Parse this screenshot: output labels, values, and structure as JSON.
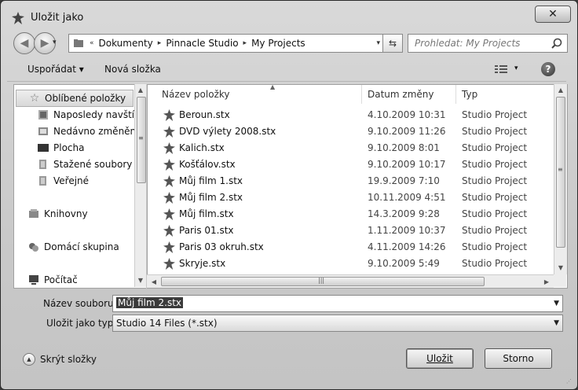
{
  "window": {
    "title": "Uložit jako",
    "close_label": "✕"
  },
  "address": {
    "prefix": "«",
    "segments": [
      "Dokumenty",
      "Pinnacle Studio",
      "My Projects"
    ],
    "separator": "▸",
    "dropdown": "▾"
  },
  "search": {
    "placeholder": "Prohledat: My Projects"
  },
  "toolbar": {
    "organize": "Uspořádat ▾",
    "new_folder": "Nová složka",
    "views_dropdown": "▾",
    "help": "?"
  },
  "nav": {
    "favorites": "Oblíbené položky",
    "recent_places": "Naposledy navštíve",
    "recently_changed": "Nedávno změněné",
    "desktop": "Plocha",
    "downloads": "Stažené soubory",
    "public": "Veřejné",
    "libraries": "Knihovny",
    "homegroup": "Domácí skupina",
    "computer": "Počítač"
  },
  "columns": {
    "name": "Název položky",
    "date": "Datum změny",
    "type": "Typ"
  },
  "files": [
    {
      "name": "Beroun.stx",
      "date": "4.10.2009 10:31",
      "type": "Studio Project"
    },
    {
      "name": "DVD výlety 2008.stx",
      "date": "9.10.2009 11:26",
      "type": "Studio Project"
    },
    {
      "name": "Kalich.stx",
      "date": "9.10.2009 8:01",
      "type": "Studio Project"
    },
    {
      "name": "Košťálov.stx",
      "date": "9.10.2009 10:17",
      "type": "Studio Project"
    },
    {
      "name": "Můj film 1.stx",
      "date": "19.9.2009 7:10",
      "type": "Studio Project"
    },
    {
      "name": "Můj film 2.stx",
      "date": "10.11.2009 4:51",
      "type": "Studio Project"
    },
    {
      "name": "Můj film.stx",
      "date": "14.3.2009 9:28",
      "type": "Studio Project"
    },
    {
      "name": "Paris 01.stx",
      "date": "1.11.2009 10:37",
      "type": "Studio Project"
    },
    {
      "name": "Paris 03 okruh.stx",
      "date": "4.11.2009 14:26",
      "type": "Studio Project"
    },
    {
      "name": "Skryje.stx",
      "date": "9.10.2009 5:49",
      "type": "Studio Project"
    }
  ],
  "form": {
    "filename_label": "Název souboru:",
    "filename_value": "Můj film 2.stx",
    "filetype_label": "Uložit jako typ:",
    "filetype_value": "Studio 14 Files (*.stx)"
  },
  "footer": {
    "hide_folders": "Skrýt složky",
    "save": "Uložit",
    "cancel": "Storno"
  }
}
